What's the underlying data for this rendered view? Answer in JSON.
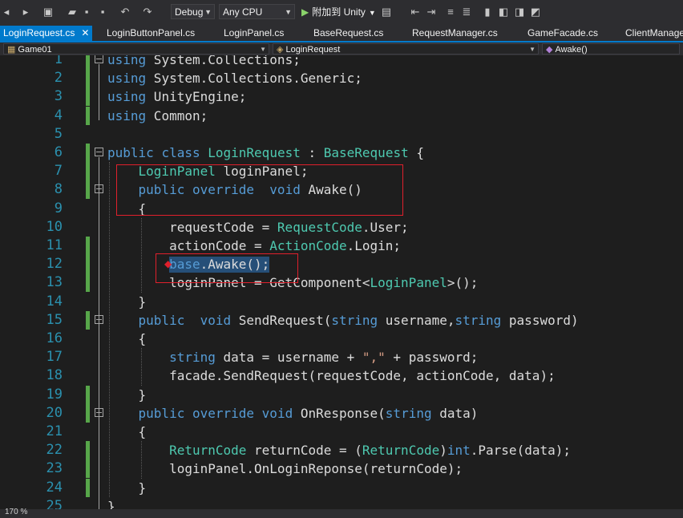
{
  "toolbar": {
    "config": "Debug",
    "platform": "Any CPU",
    "run_label": "附加到 Unity"
  },
  "tabs": [
    {
      "label": "LoginRequest.cs",
      "active": true
    },
    {
      "label": "LoginButtonPanel.cs"
    },
    {
      "label": "LoginPanel.cs"
    },
    {
      "label": "BaseRequest.cs"
    },
    {
      "label": "RequestManager.cs"
    },
    {
      "label": "GameFacade.cs"
    },
    {
      "label": "ClientManager"
    }
  ],
  "nav": {
    "project": "Game01",
    "class": "LoginRequest",
    "member": "Awake()"
  },
  "code": {
    "lines": [
      [
        [
          "k",
          "using"
        ],
        [
          "p",
          " System.Collections;"
        ]
      ],
      [
        [
          "k",
          "using"
        ],
        [
          "p",
          " System.Collections.Generic;"
        ]
      ],
      [
        [
          "k",
          "using"
        ],
        [
          "p",
          " UnityEngine;"
        ]
      ],
      [
        [
          "k",
          "using"
        ],
        [
          "p",
          " Common;"
        ]
      ],
      [],
      [
        [
          "k",
          "public"
        ],
        [
          "p",
          " "
        ],
        [
          "k",
          "class"
        ],
        [
          "p",
          " "
        ],
        [
          "t",
          "LoginRequest"
        ],
        [
          "p",
          " : "
        ],
        [
          "t",
          "BaseRequest"
        ],
        [
          "p",
          " {"
        ]
      ],
      [
        [
          "p",
          "    "
        ],
        [
          "t",
          "LoginPanel"
        ],
        [
          "p",
          " loginPanel;"
        ]
      ],
      [
        [
          "p",
          "    "
        ],
        [
          "k",
          "public"
        ],
        [
          "p",
          " "
        ],
        [
          "k",
          "override"
        ],
        [
          "p",
          "  "
        ],
        [
          "k",
          "void"
        ],
        [
          "p",
          " Awake()"
        ]
      ],
      [
        [
          "p",
          "    {"
        ]
      ],
      [
        [
          "p",
          "        requestCode = "
        ],
        [
          "t",
          "RequestCode"
        ],
        [
          "p",
          ".User;"
        ]
      ],
      [
        [
          "p",
          "        actionCode = "
        ],
        [
          "t",
          "ActionCode"
        ],
        [
          "p",
          ".Login;"
        ]
      ],
      [
        [
          "p",
          "        "
        ],
        [
          "k",
          "base"
        ],
        [
          "p",
          ".Awake();"
        ]
      ],
      [
        [
          "p",
          "        loginPanel = GetComponent<"
        ],
        [
          "t",
          "LoginPanel"
        ],
        [
          "p",
          ">();"
        ]
      ],
      [
        [
          "p",
          "    }"
        ]
      ],
      [
        [
          "p",
          "    "
        ],
        [
          "k",
          "public"
        ],
        [
          "p",
          "  "
        ],
        [
          "k",
          "void"
        ],
        [
          "p",
          " SendRequest("
        ],
        [
          "k",
          "string"
        ],
        [
          "p",
          " username,"
        ],
        [
          "k",
          "string"
        ],
        [
          "p",
          " password)"
        ]
      ],
      [
        [
          "p",
          "    {"
        ]
      ],
      [
        [
          "p",
          "        "
        ],
        [
          "k",
          "string"
        ],
        [
          "p",
          " data = username + "
        ],
        [
          "s",
          "\",\""
        ],
        [
          "p",
          " + password;"
        ]
      ],
      [
        [
          "p",
          "        facade.SendRequest(requestCode, actionCode, data);"
        ]
      ],
      [
        [
          "p",
          "    }"
        ]
      ],
      [
        [
          "p",
          "    "
        ],
        [
          "k",
          "public"
        ],
        [
          "p",
          " "
        ],
        [
          "k",
          "override"
        ],
        [
          "p",
          " "
        ],
        [
          "k",
          "void"
        ],
        [
          "p",
          " OnResponse("
        ],
        [
          "k",
          "string"
        ],
        [
          "p",
          " data)"
        ]
      ],
      [
        [
          "p",
          "    {"
        ]
      ],
      [
        [
          "p",
          "        "
        ],
        [
          "t",
          "ReturnCode"
        ],
        [
          "p",
          " returnCode = ("
        ],
        [
          "t",
          "ReturnCode"
        ],
        [
          "p",
          ")"
        ],
        [
          "k",
          "int"
        ],
        [
          "p",
          ".Parse(data);"
        ]
      ],
      [
        [
          "p",
          "        loginPanel.OnLoginReponse(returnCode);"
        ]
      ],
      [
        [
          "p",
          "    }"
        ]
      ],
      [
        [
          "p",
          "}"
        ]
      ]
    ]
  },
  "status": {
    "zoom": "170 %"
  }
}
